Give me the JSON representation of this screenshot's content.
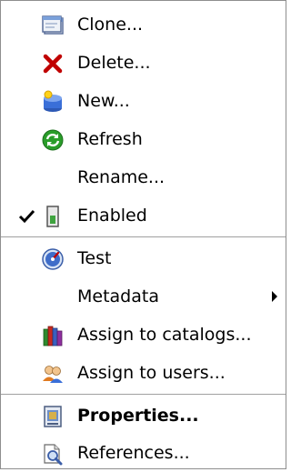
{
  "menu": {
    "items": [
      {
        "label": "Clone...",
        "icon": "clone-icon"
      },
      {
        "label": "Delete...",
        "icon": "delete-x-icon"
      },
      {
        "label": "New...",
        "icon": "new-database-icon"
      },
      {
        "label": "Refresh",
        "icon": "refresh-icon"
      },
      {
        "label": "Rename...",
        "icon": ""
      },
      {
        "label": "Enabled",
        "icon": "enabled-indicator-icon",
        "checked": true
      },
      {
        "label": "Test",
        "icon": "test-gauge-icon"
      },
      {
        "label": "Metadata",
        "icon": "",
        "submenu": true
      },
      {
        "label": "Assign to catalogs...",
        "icon": "catalogs-books-icon"
      },
      {
        "label": "Assign to users...",
        "icon": "users-icon"
      },
      {
        "label": "Properties...",
        "icon": "properties-icon",
        "bold": true
      },
      {
        "label": "References...",
        "icon": "references-icon"
      }
    ]
  },
  "colors": {
    "delete": "#cc0000",
    "refresh": "#2a9d2a",
    "database": "#3a6fd8",
    "enabled": "#3fa33f"
  }
}
